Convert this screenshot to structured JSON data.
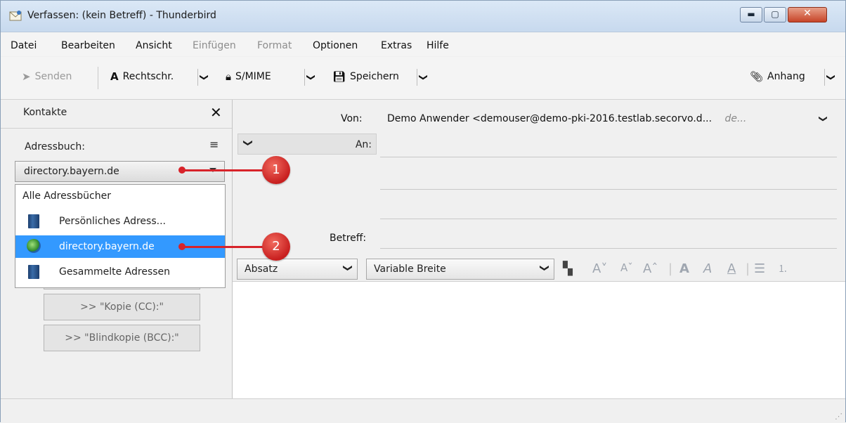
{
  "window": {
    "title": "Verfassen: (kein Betreff) - Thunderbird",
    "controls": {
      "minimize": "▬",
      "maximize": "▢",
      "close": "✕"
    }
  },
  "menu": {
    "items": [
      {
        "label": "Datei",
        "enabled": true
      },
      {
        "label": "Bearbeiten",
        "enabled": true
      },
      {
        "label": "Ansicht",
        "enabled": true
      },
      {
        "label": "Einfügen",
        "enabled": false
      },
      {
        "label": "Format",
        "enabled": false
      },
      {
        "label": "Optionen",
        "enabled": true
      },
      {
        "label": "Extras",
        "enabled": true
      },
      {
        "label": "Hilfe",
        "enabled": true
      }
    ]
  },
  "toolbar": {
    "send": "Senden",
    "spellcheck": "Rechtschr.",
    "smime": "S/MIME",
    "save": "Speichern",
    "attach": "Anhang",
    "dropdown_glyph": "❯"
  },
  "sidebar": {
    "title": "Kontakte",
    "close_glyph": "✕",
    "addressbook_label": "Adressbuch:",
    "menu_glyph": "≡",
    "selected_book": "directory.bayern.de",
    "dropdown_items": [
      {
        "label": "Alle Adressbücher",
        "icon": "none",
        "selected": false
      },
      {
        "label": "Persönliches Adress...",
        "icon": "address-book-icon",
        "selected": false
      },
      {
        "label": "directory.bayern.de",
        "icon": "globe-icon",
        "selected": true
      },
      {
        "label": "Gesammelte Adressen",
        "icon": "address-book-icon",
        "selected": false
      }
    ],
    "buttons": {
      "cc": ">> \"Kopie (CC):\"",
      "bcc": ">> \"Blindkopie (BCC):\""
    }
  },
  "callouts": {
    "one": "1",
    "two": "2"
  },
  "compose": {
    "from_label": "Von:",
    "from_value": "Demo Anwender <demouser@demo-pki-2016.testlab.secorvo.d...",
    "from_identity": "de...",
    "to_label": "An:",
    "subject_label": "Betreff:",
    "chevron": "❯"
  },
  "format": {
    "paragraph": "Absatz",
    "font": "Variable Breite",
    "arrow": "❯"
  },
  "colors": {
    "selection": "#3399ff",
    "callout": "#d8232a"
  }
}
